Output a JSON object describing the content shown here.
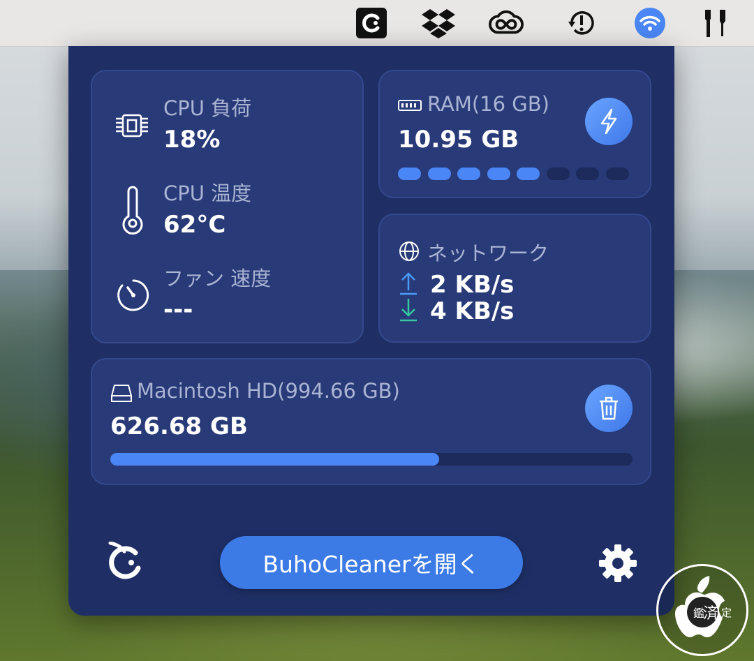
{
  "colors": {
    "panel_bg": "#1f2f66",
    "card_bg": "#283a78",
    "accent": "#4a86f5",
    "upload": "#4a9af5",
    "download": "#36c9a0"
  },
  "menubar": {
    "icons": [
      "buhocleaner-icon",
      "dropbox-icon",
      "creative-cloud-icon",
      "time-machine-icon",
      "wifi-icon",
      "tools-icon"
    ]
  },
  "cpu": {
    "load_label": "CPU 負荷",
    "load_value": "18%",
    "temp_label": "CPU 温度",
    "temp_value": "62°C",
    "fan_label": "ファン 速度",
    "fan_value": "---"
  },
  "ram": {
    "label": "RAM(16 GB)",
    "value": "10.95 GB",
    "filled_segments": 5,
    "total_segments": 8
  },
  "network": {
    "label": "ネットワーク",
    "upload": "2 KB/s",
    "download": "4 KB/s"
  },
  "disk": {
    "label": "Macintosh HD(994.66 GB)",
    "value": "626.68 GB",
    "used_fraction": 0.63
  },
  "footer": {
    "open_button": "BuhoCleanerを開く"
  },
  "watermark": {
    "text": "鑑",
    "text2": "済",
    "text3": "定"
  }
}
